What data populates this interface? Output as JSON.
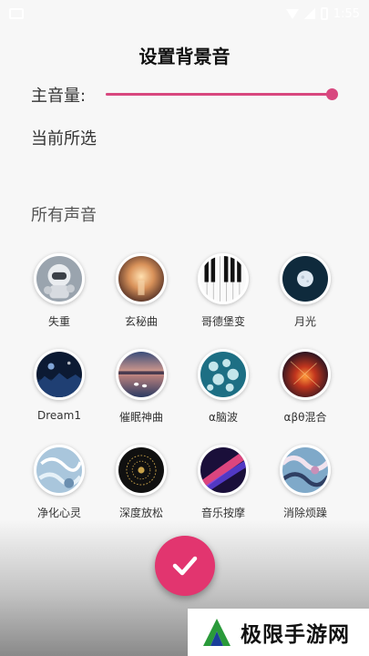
{
  "status_bar": {
    "time": "1:55"
  },
  "page": {
    "title": "设置背景音"
  },
  "volume": {
    "label": "主音量:",
    "level": 1.0
  },
  "sections": {
    "current_label": "当前所选",
    "all_label": "所有声音"
  },
  "sounds": [
    {
      "name": "失重",
      "icon": "astronaut-image"
    },
    {
      "name": "玄秘曲",
      "icon": "candle-glow-image"
    },
    {
      "name": "哥德堡变",
      "icon": "piano-keys-image"
    },
    {
      "name": "月光",
      "icon": "moon-image"
    },
    {
      "name": "Dream1",
      "icon": "night-city-image"
    },
    {
      "name": "催眠神曲",
      "icon": "lake-swans-image"
    },
    {
      "name": "α脑波",
      "icon": "neural-cells-image"
    },
    {
      "name": "αβθ混合",
      "icon": "fire-sparks-image"
    },
    {
      "name": "净化心灵",
      "icon": "frost-image"
    },
    {
      "name": "深度放松",
      "icon": "dark-mandala-image"
    },
    {
      "name": "音乐按摩",
      "icon": "pink-light-streak-image"
    },
    {
      "name": "消除烦躁",
      "icon": "marble-swirl-image"
    }
  ],
  "confirm": {
    "icon": "checkmark-icon"
  },
  "watermark": {
    "text": "极限手游网"
  },
  "colors": {
    "accent": "#e2356f",
    "slider": "#d8487f"
  }
}
